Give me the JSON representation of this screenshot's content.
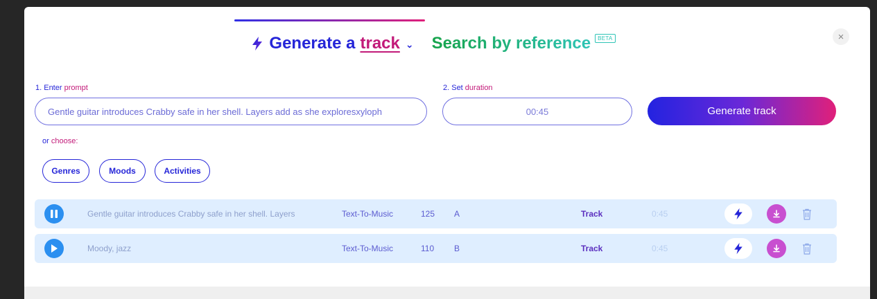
{
  "header": {
    "generate_prefix": "Generate a",
    "generate_word": "track",
    "search_tab": "Search by reference",
    "beta_badge": "BETA",
    "close_symbol": "×"
  },
  "prompt": {
    "label_num": "1. Enter ",
    "label_word": "prompt",
    "value": "Gentle guitar introduces Crabby safe in her shell. Layers add as she exploresxyloph"
  },
  "duration": {
    "label_num": "2. Set ",
    "label_word": "duration",
    "value": "00:45"
  },
  "generate_button": "Generate track",
  "choose": {
    "label_a": "or ",
    "label_b": "choose:",
    "chips": [
      "Genres",
      "Moods",
      "Activities"
    ]
  },
  "tracks": [
    {
      "description": "Gentle guitar introduces Crabby safe in her shell. Layers",
      "type": "Text-To-Music",
      "bpm": "125",
      "key": "A",
      "kind": "Track",
      "duration": "0:45",
      "state": "playing"
    },
    {
      "description": "Moody, jazz",
      "type": "Text-To-Music",
      "bpm": "110",
      "key": "B",
      "kind": "Track",
      "duration": "0:45",
      "state": "paused"
    }
  ],
  "icons": {
    "bolt": "bolt-icon",
    "chevron": "chevron-down-icon",
    "close": "close-icon",
    "pause": "pause-icon",
    "play": "play-icon",
    "download": "download-icon",
    "trash": "trash-icon"
  },
  "colors": {
    "primary_blue": "#2525d8",
    "magenta": "#c21a79",
    "teal_green": "#2ec4b6",
    "row_bg": "#dfeeff",
    "play_blue": "#2b8ff0",
    "download_purple": "#c84fd0"
  }
}
